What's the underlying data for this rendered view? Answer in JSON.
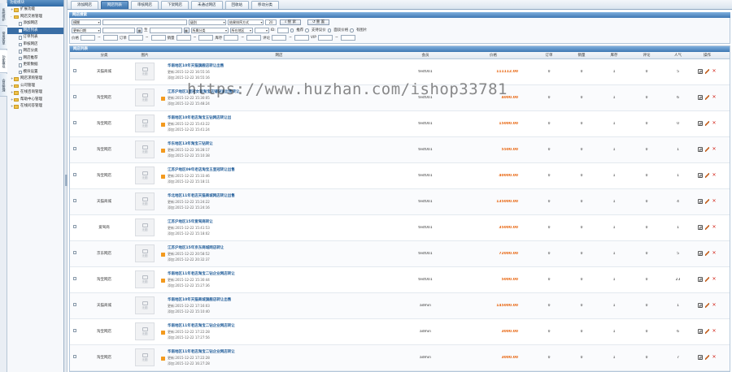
{
  "vertical_tabs": [
    {
      "label": "系统维护"
    },
    {
      "label": "常用菜单"
    },
    {
      "label": "功能模块"
    },
    {
      "label": "会员管理"
    }
  ],
  "sidebar": {
    "title": "功能模块",
    "items": [
      {
        "label": "扩展功能",
        "type": "folder",
        "expand": "+"
      },
      {
        "label": "网店交易管理",
        "type": "folder",
        "expand": "-"
      },
      {
        "label": "添加网店",
        "type": "sub"
      },
      {
        "label": "网店列表",
        "type": "sub",
        "active": true
      },
      {
        "label": "订单列表",
        "type": "sub"
      },
      {
        "label": "审核网店",
        "type": "sub"
      },
      {
        "label": "网店分类",
        "type": "sub"
      },
      {
        "label": "网店推荐",
        "type": "sub"
      },
      {
        "label": "更新数据",
        "type": "sub"
      },
      {
        "label": "模块设置",
        "type": "sub"
      },
      {
        "label": "网店求购管理",
        "type": "folder",
        "expand": "+"
      },
      {
        "label": "公司管理",
        "type": "folder",
        "expand": "+"
      },
      {
        "label": "在线咨询管理",
        "type": "folder",
        "expand": "+"
      },
      {
        "label": "帮助中心管理",
        "type": "folder",
        "expand": "+"
      },
      {
        "label": "在线问答管理",
        "type": "folder",
        "expand": "+"
      }
    ]
  },
  "top_tabs": [
    {
      "label": "添加网店",
      "active": false
    },
    {
      "label": "网店列表",
      "active": true
    },
    {
      "label": "审核网店",
      "active": false
    },
    {
      "label": "下架网店",
      "active": false
    },
    {
      "label": "未通过网店",
      "active": false
    },
    {
      "label": "回收站",
      "active": false
    },
    {
      "label": "移动分类",
      "active": false
    }
  ],
  "search": {
    "title": "网店搜索",
    "field_select": "模糊",
    "level_select": "级别",
    "sort_select": "结果排序方式",
    "page_size": "20",
    "search_btn": "搜 索",
    "reset_btn": "重 置",
    "date_select": "更新日期",
    "date_sep": "至",
    "category_select": "所属分类",
    "area_select": "所在地区",
    "id_label": "ID:",
    "opt_recommend": "推荐",
    "opt_bargain": "支持议价",
    "opt_negotiate": "面谈价格",
    "opt_hasimage": "有图片",
    "price_label": "价格",
    "order_label": "订单",
    "sales_label": "销量",
    "stock_label": "库存",
    "comment_label": "评论",
    "vip_label": "VIP"
  },
  "list": {
    "title": "网店列表",
    "columns": {
      "category": "分类",
      "image": "图片",
      "title": "网店",
      "member": "会员",
      "price": "价格",
      "orders": "订单",
      "sales": "销量",
      "stock": "库存",
      "comments": "评论",
      "popularity": "人气",
      "actions": "操作"
    },
    "rows": [
      {
        "category": "天猫商城",
        "name": "华南地区10年天猫旗舰店转让出售",
        "updated": "更新:2015-12-22 16:55:16",
        "added": "添加:2015-12-22 16:55:16",
        "member": "test001",
        "price": "111112.00",
        "orders": "0",
        "sales": "0",
        "stock": "1",
        "comments": "0",
        "popularity": "5",
        "flag": false
      },
      {
        "category": "淘宝网店",
        "name": "江苏沪地区1皇冠女装淘宝店铺快速出售转让",
        "updated": "更新:2015-12-22 15:30:05",
        "added": "添加:2015-12-22 15:48:24",
        "member": "test001",
        "price": "4000.00",
        "orders": "0",
        "sales": "0",
        "stock": "1",
        "comments": "0",
        "popularity": "6",
        "flag": true
      },
      {
        "category": "淘宝网店",
        "name": "华南地区10年老店淘宝五钻网店转让出",
        "updated": "更新:2015-12-22 15:43:22",
        "added": "添加:2015-12-22 15:41:24",
        "member": "test001",
        "price": "15000.00",
        "orders": "0",
        "sales": "0",
        "stock": "1",
        "comments": "0",
        "popularity": "0",
        "flag": true
      },
      {
        "category": "淘宝网店",
        "name": "华东地区13年淘宝三钻转让",
        "updated": "更新:2015-12-22 16:28:17",
        "added": "添加:2015-12-22 15:10:38",
        "member": "test001",
        "price": "5500.00",
        "orders": "0",
        "sales": "0",
        "stock": "1",
        "comments": "0",
        "popularity": "1",
        "flag": true
      },
      {
        "category": "淘宝网店",
        "name": "江苏沪地区09年老店淘宝五皇冠转让出售",
        "updated": "更新:2015-12-22 15:33:46",
        "added": "添加:2015-12-22 15:18:11",
        "member": "test001",
        "price": "40000.00",
        "orders": "0",
        "sales": "0",
        "stock": "1",
        "comments": "0",
        "popularity": "1",
        "flag": true
      },
      {
        "category": "天猫商城",
        "name": "华北地区11年老店天猫商城网店转让出售",
        "updated": "更新:2015-12-22 15:24:22",
        "added": "添加:2015-12-22 15:24:16",
        "member": "test001",
        "price": "135000.00",
        "orders": "0",
        "sales": "0",
        "stock": "1",
        "comments": "0",
        "popularity": "4",
        "flag": false
      },
      {
        "category": "爱驾商",
        "name": "江苏沪地区15年爱驾商转让",
        "updated": "更新:2015-12-22 15:41:53",
        "added": "添加:2015-12-22 15:18:02",
        "member": "test001",
        "price": "35000.00",
        "orders": "0",
        "sales": "0",
        "stock": "1",
        "comments": "0",
        "popularity": "1",
        "flag": false
      },
      {
        "category": "京东网店",
        "name": "江苏沪地区15年京东商城网店转让",
        "updated": "更新:2015-12-22 20:58:52",
        "added": "添加:2015-12-22 20:32:37",
        "member": "test001",
        "price": "72000.00",
        "orders": "0",
        "sales": "0",
        "stock": "1",
        "comments": "0",
        "popularity": "5",
        "flag": true
      },
      {
        "category": "淘宝网店",
        "name": "华南地区11年老店淘宝二钻企业网店转让",
        "updated": "更新:2015-12-22 15:30:44",
        "added": "添加:2015-12-22 15:27:36",
        "member": "test001",
        "price": "5000.00",
        "orders": "0",
        "sales": "0",
        "stock": "1",
        "comments": "0",
        "popularity": "23",
        "flag": true
      },
      {
        "category": "天猫商城",
        "name": "华南地区10年天猫商城旗舰店转让出售",
        "updated": "更新:2015-12-22 17:16:03",
        "added": "添加:2015-12-22 15:10:40",
        "member": "admin",
        "price": "145000.00",
        "orders": "0",
        "sales": "0",
        "stock": "1",
        "comments": "0",
        "popularity": "1",
        "flag": false
      },
      {
        "category": "淘宝网店",
        "name": "华南地区11年老店淘宝二钻企业网店转让",
        "updated": "更新:2015-12-22 17:22:28",
        "added": "添加:2015-12-22 17:27:56",
        "member": "admin",
        "price": "3000.00",
        "orders": "0",
        "sales": "0",
        "stock": "1",
        "comments": "0",
        "popularity": "6",
        "flag": true
      },
      {
        "category": "淘宝网店",
        "name": "华南地区11年老店淘宝二钻企业网店转让",
        "updated": "更新:2015-12-22 17:22:28",
        "added": "添加:2015-12-22 16:27:28",
        "member": "admin",
        "price": "3000.00",
        "orders": "0",
        "sales": "0",
        "stock": "1",
        "comments": "0",
        "popularity": "7",
        "flag": true
      }
    ],
    "no_image_text": "无图"
  },
  "watermark": "https://www.huzhan.com/ishop33781"
}
